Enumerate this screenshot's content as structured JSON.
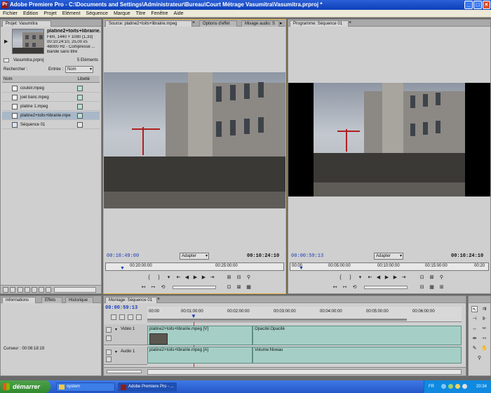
{
  "window": {
    "title": "Adobe Premiere Pro - C:\\Documents and Settings\\Administrateur\\Bureau\\Court Métrage Vasumitra\\Vasumitra.prproj *",
    "app_icon": "Pr"
  },
  "menu": [
    "Fichier",
    "Edition",
    "Projet",
    "Elément",
    "Séquence",
    "Marque",
    "Titre",
    "Fenêtre",
    "Aide"
  ],
  "project": {
    "tab": "Projet: Vasumitra",
    "clip_name": "platine2+toits+librairie...",
    "clip_info": [
      "Film, 1440 × 1080 (1,33)",
      "00:10:24:10, 25,00 i/s",
      "48000 Hz - Compressé ...",
      "Bande sans titre"
    ],
    "project_name": "Vasumitra.prproj",
    "count": "5 Eléments",
    "search_label": "Rechercher :",
    "entree_label": "Entrée :",
    "entree_value": "Nom",
    "col_name": "Nom",
    "col_label": "Libellé",
    "items": [
      {
        "name": "couloir.mpeg",
        "selected": false
      },
      {
        "name": "joel banc.mpeg",
        "selected": false
      },
      {
        "name": "platine 1.mpeg",
        "selected": false
      },
      {
        "name": "platine2+toits+librairie.mpe",
        "selected": true
      },
      {
        "name": "Séquence 01",
        "selected": false
      }
    ]
  },
  "info_panel": {
    "tabs": [
      "Informations",
      "Effets",
      "Historique"
    ],
    "cursor": "Curseur : 00:08:18:19"
  },
  "source": {
    "tabs": [
      "Source: platine2+toits+librairie.mpeg",
      "Options d'effet",
      "Mixage audio: S"
    ],
    "tc_left": "00:18:49:00",
    "zoom": "Adapter",
    "tc_right": "00:10:24:10",
    "ruler": [
      "00:20:00:00",
      "00:25:00:00"
    ]
  },
  "program": {
    "tab": "Programme: Séquence 01",
    "tc_left": "00:00:59:13",
    "zoom": "Adapter",
    "tc_right": "00:10:24:10",
    "ruler": [
      "00:00",
      "00:05:00:00",
      "00:10:00:00",
      "00:15:00:00",
      "00:20"
    ]
  },
  "timeline": {
    "tab": "Montage: Séquence 01",
    "tc": "00:00:59:13",
    "ruler": [
      "00:00",
      "00:01:00:00",
      "00:02:00:00",
      "00:03:00:00",
      "00:04:00:00",
      "00:05:00:00",
      "00:06:00:00"
    ],
    "video_track": "Vidéo 1",
    "video_clip": "platine2+toits+librairie.mpeg [V]",
    "video_fx": "Opacité:Opacité",
    "audio_track": "Audio 1",
    "audio_clip": "platine2+toits+librairie.mpeg [A]",
    "audio_fx": "Volume:Niveau"
  },
  "taskbar": {
    "start": "démarrer",
    "items": [
      "system",
      "Adobe Premiere Pro - ..."
    ],
    "lang": "FR",
    "time": "20:34"
  }
}
